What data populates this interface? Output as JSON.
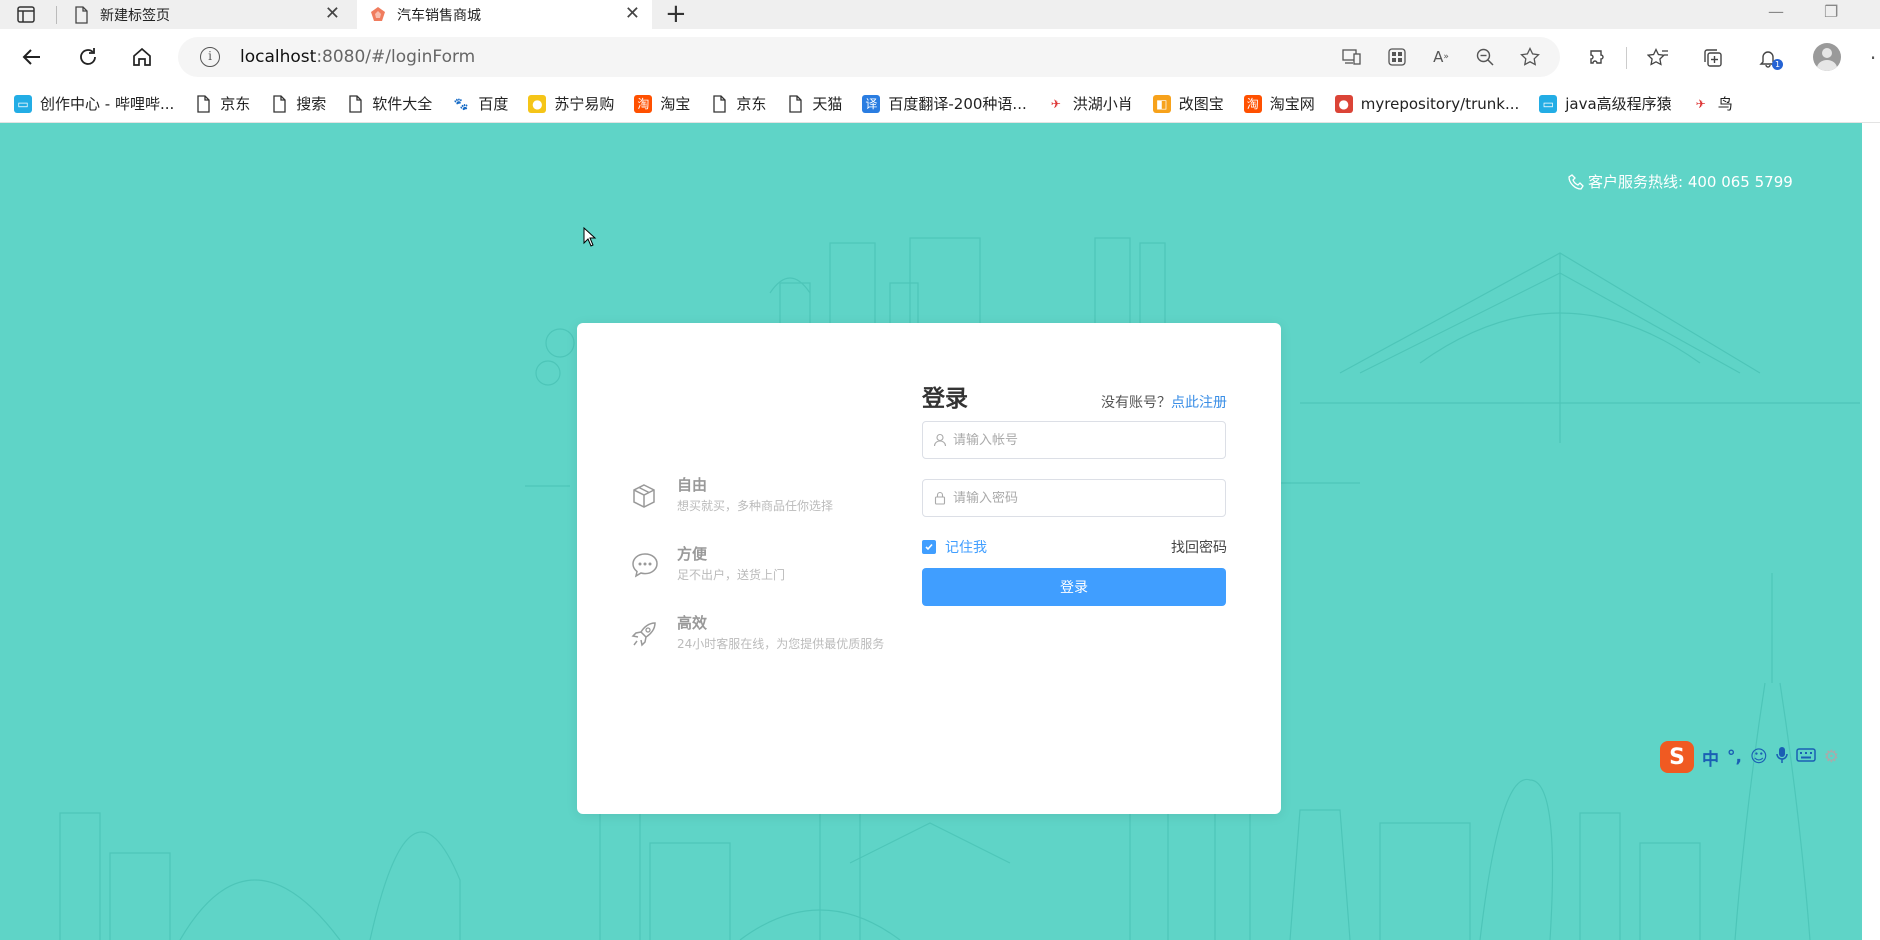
{
  "browser": {
    "tabs": [
      {
        "title": "新建标签页",
        "active": false
      },
      {
        "title": "汽车销售商城",
        "active": true
      }
    ],
    "url_host": "localhost",
    "url_rest": ":8080/#/loginForm",
    "bookmarks": [
      {
        "label": "创作中心 - 哔哩哔...",
        "icon": "bilibili-icon"
      },
      {
        "label": "京东",
        "icon": "page-icon"
      },
      {
        "label": "搜索",
        "icon": "page-icon"
      },
      {
        "label": "软件大全",
        "icon": "page-icon"
      },
      {
        "label": "百度",
        "icon": "baidu-icon"
      },
      {
        "label": "苏宁易购",
        "icon": "suning-icon"
      },
      {
        "label": "淘宝",
        "icon": "taobao-icon"
      },
      {
        "label": "京东",
        "icon": "page-icon"
      },
      {
        "label": "天猫",
        "icon": "page-icon"
      },
      {
        "label": "百度翻译-200种语...",
        "icon": "translate-icon"
      },
      {
        "label": "洪湖小肖",
        "icon": "bird-icon"
      },
      {
        "label": "改图宝",
        "icon": "gaitubao-icon"
      },
      {
        "label": "淘宝网",
        "icon": "taobao-icon"
      },
      {
        "label": "myrepository/trunk...",
        "icon": "chrome-icon"
      },
      {
        "label": "java高级程序猿",
        "icon": "bilibili-icon"
      },
      {
        "label": "鸟",
        "icon": "bird-icon"
      }
    ]
  },
  "page": {
    "hotline": "客户服务热线: 400 065 5799",
    "features": [
      {
        "title": "自由",
        "desc": "想买就买，多种商品任你选择",
        "icon": "box-icon"
      },
      {
        "title": "方便",
        "desc": "足不出户，送货上门",
        "icon": "chat-icon"
      },
      {
        "title": "高效",
        "desc": "24小时客服在线，为您提供最优质服务",
        "icon": "rocket-icon"
      }
    ],
    "login": {
      "title": "登录",
      "no_account": "没有账号？",
      "register": "点此注册",
      "account_placeholder": "请输入帐号",
      "password_placeholder": "请输入密码",
      "remember": "记住我",
      "forgot": "找回密码",
      "submit": "登录"
    }
  },
  "ime": {
    "mode": "中",
    "punct": "°,"
  },
  "colors": {
    "page_bg": "#5fd4c7",
    "primary": "#409eff"
  }
}
